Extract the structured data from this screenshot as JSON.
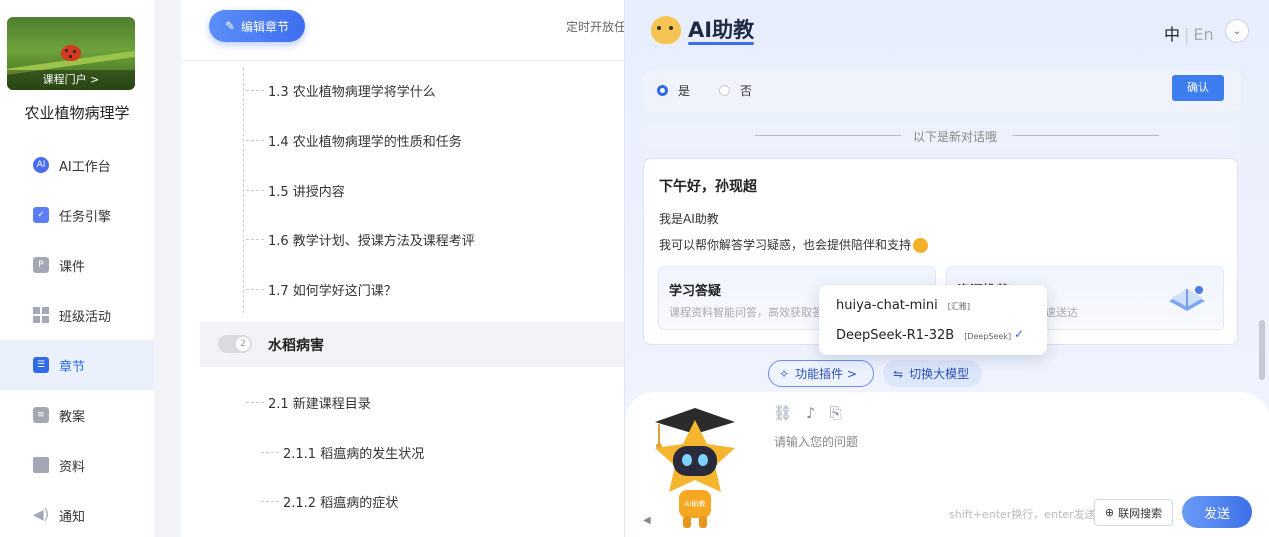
{
  "sidebar": {
    "cover_link": "课程门户 >",
    "course_title": "农业植物病理学",
    "items": [
      {
        "label": "AI工作台",
        "icon": "ai-icon",
        "color": "#4a6cf0"
      },
      {
        "label": "任务引擎",
        "icon": "task-icon",
        "color": "#5b7ef6"
      },
      {
        "label": "课件",
        "icon": "courseware-icon",
        "color": "#a3a8b4"
      },
      {
        "label": "班级活动",
        "icon": "grid-icon",
        "color": "#a3a8b4"
      },
      {
        "label": "章节",
        "icon": "list-icon",
        "color": "#2f6be8",
        "active": true
      },
      {
        "label": "教案",
        "icon": "doc-icon",
        "color": "#a3a8b4"
      },
      {
        "label": "资料",
        "icon": "folder-icon",
        "color": "#a3a8b4"
      },
      {
        "label": "通知",
        "icon": "speaker-icon",
        "color": "#a3a8b4"
      }
    ]
  },
  "content": {
    "edit_button": "编辑章节",
    "timer_label": "定时开放任",
    "sections": [
      "1.3 农业植物病理学将学什么",
      "1.4 农业植物病理学的性质和任务",
      "1.5 讲授内容",
      "1.6 教学计划、授课方法及课程考评",
      "1.7 如何学好这门课？"
    ],
    "chapter": {
      "number": "2",
      "title": "水稻病害"
    },
    "subsections": [
      "2.1 新建课程目录",
      "2.1.1 稻瘟病的发生状况",
      "2.1.2 稻瘟病的症状"
    ]
  },
  "assistant": {
    "title": "AI助教",
    "lang_zh": "中",
    "lang_en": "En",
    "options": {
      "yes": "是",
      "no": "否",
      "confirm": "确认"
    },
    "new_chat": "以下是新对话哦",
    "greeting": "下午好，孙现超",
    "intro": "我是AI助教",
    "offer": "我可以帮你解答学习疑惑，也会提供陪伴和支持",
    "feature_qa": {
      "title": "学习答疑",
      "desc": "课程资料智能问答，高效获取答"
    },
    "feature_res": {
      "title": "资源推荐",
      "desc": "速送达"
    },
    "models": [
      {
        "name": "huiya-chat-mini",
        "tag": "[汇雅]"
      },
      {
        "name": "DeepSeek-R1-32B",
        "tag": "[DeepSeek]",
        "selected": true
      }
    ],
    "plugins_button": "功能插件 >",
    "switch_model_button": "切换大模型",
    "input_placeholder": "请输入您的问题",
    "hint": "shift+enter换行，enter发送",
    "web_search": "联网搜索",
    "send": "发送",
    "robot_badge": "AI助教",
    "accent": "#3d6ef0"
  }
}
